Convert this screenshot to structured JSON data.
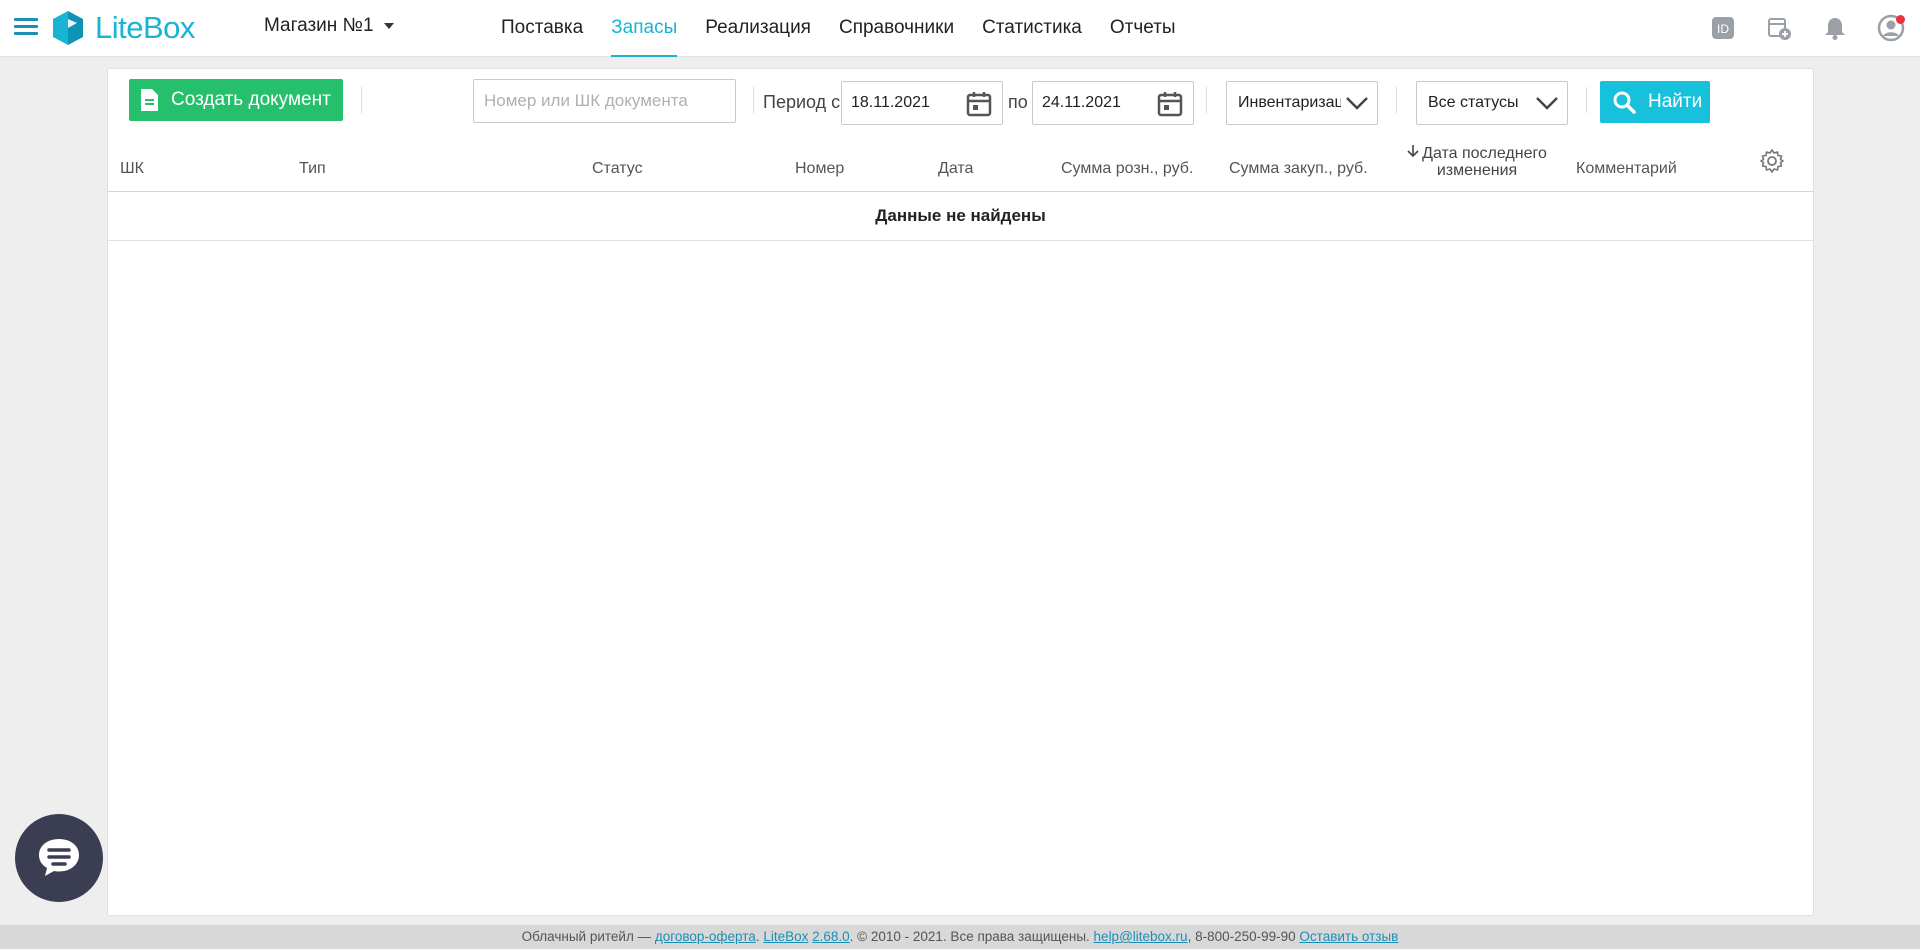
{
  "header": {
    "logo_text": "LiteBox",
    "store": "Магазин №1",
    "nav": [
      {
        "label": "Поставка"
      },
      {
        "label": "Запасы"
      },
      {
        "label": "Реализация"
      },
      {
        "label": "Справочники"
      },
      {
        "label": "Статистика"
      },
      {
        "label": "Отчеты"
      }
    ],
    "active_nav": "Запасы",
    "id_icon_text": "ID"
  },
  "toolbar": {
    "create_label": "Создать документ",
    "search_placeholder": "Номер или ШК документа",
    "period_from_label": "Период с",
    "date_from": "18.11.2021",
    "period_to_label": "по",
    "date_to": "24.11.2021",
    "type_select": "Инвентаризация",
    "status_select": "Все статусы",
    "find_label": "Найти"
  },
  "table": {
    "columns": {
      "barcode": "ШК",
      "type": "Тип",
      "status": "Статус",
      "number": "Номер",
      "date": "Дата",
      "retail_sum": "Сумма розн., руб.",
      "purchase_sum": "Сумма закуп., руб.",
      "last_modified_line1": "Дата последнего",
      "last_modified_line2": "изменения",
      "comment": "Комментарий"
    },
    "empty_text": "Данные не найдены"
  },
  "footer": {
    "text_before": "Облачный ритейл —",
    "offer_link": "договор-оферта",
    "brand_link": "LiteBox",
    "version_link": "2.68.0",
    "copyright": ". © 2010 - 2021. Все права защищены.",
    "email_link": "help@litebox.ru",
    "phone": ", 8-800-250-99-90",
    "feedback_link": "Оставить отзыв"
  },
  "colors": {
    "accent": "#17b4d3",
    "create_button": "#26bf6b",
    "find_button": "#17c1dc",
    "chat_bubble": "#3b3d52"
  }
}
